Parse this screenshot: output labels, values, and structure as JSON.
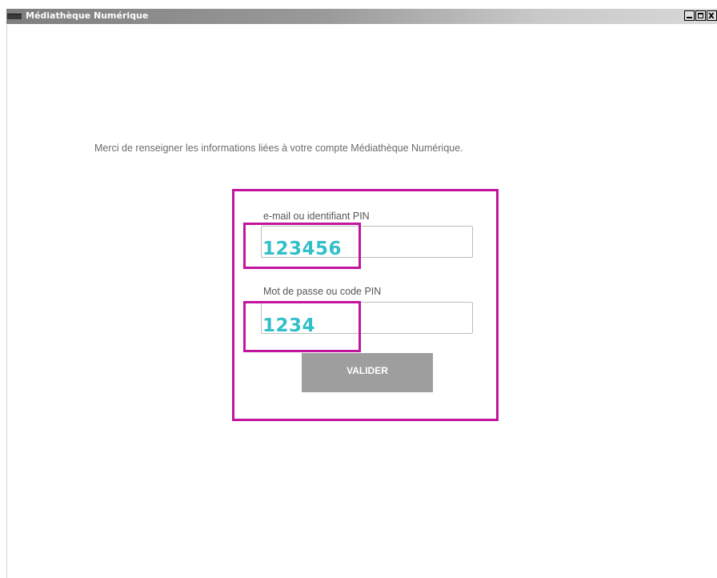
{
  "window": {
    "title": "Médiathèque Numérique",
    "app_icon": "app-icon",
    "controls": {
      "minimize_icon": "minimize-icon",
      "maximize_icon": "maximize-icon",
      "close_icon": "close-icon",
      "close_glyph": "x"
    }
  },
  "login": {
    "intro": "Merci de renseigner les informations liées à votre compte Médiathèque Numérique.",
    "identifier": {
      "label": "e-mail ou identifiant PIN",
      "value": "123456",
      "placeholder": ""
    },
    "password": {
      "label": "Mot de passe ou code PIN",
      "value": "1234",
      "placeholder": ""
    },
    "submit_label": "VALIDER"
  },
  "colors": {
    "titlebar_dark": "#7f7f7f",
    "titlebar_light": "#d8d8d8",
    "annotation_magenta": "#c2149e",
    "annotation_value_cyan": "#32bfc9",
    "button_gray": "#9e9e9e",
    "text_gray": "#6b6b6b"
  }
}
